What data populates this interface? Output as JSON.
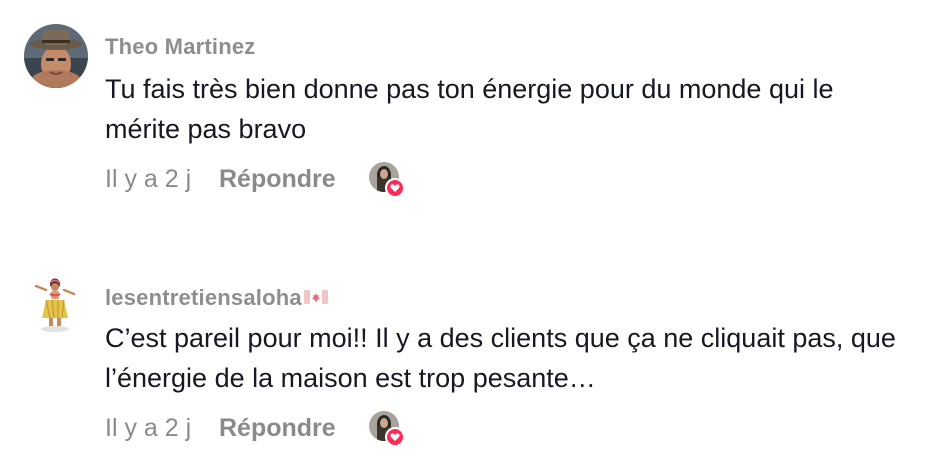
{
  "colors": {
    "username": "#8e8e8e",
    "text": "#161823",
    "meta": "#8a8a8a",
    "heart": "#fe2c55"
  },
  "comments": [
    {
      "username": "Theo Martinez",
      "text": "Tu fais très bien donne pas ton énergie pour du monde qui le mérite pas bravo",
      "time": "Il y a 2 j",
      "reply_label": "Répondre",
      "avatar_icon": "man-with-hat-avatar",
      "liked_by_creator": true
    },
    {
      "username": "lesentretiensaloha",
      "username_flag": "canada-flag-icon",
      "text": "C’est pareil pour moi!! Il y a des clients que ça ne cliquait pas, que l’énergie de la maison est trop pesante…",
      "time": "Il y a 2 j",
      "reply_label": "Répondre",
      "avatar_icon": "hula-dancer-avatar",
      "liked_by_creator": true
    }
  ]
}
